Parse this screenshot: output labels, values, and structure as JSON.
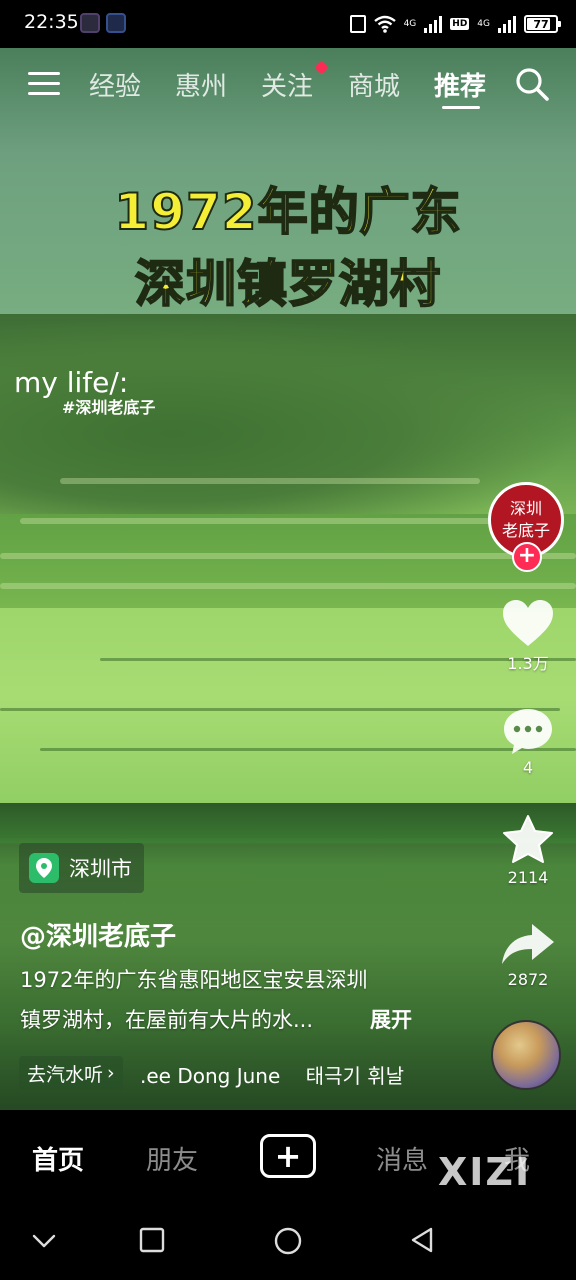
{
  "status_bar": {
    "time": "22:35",
    "network_1": "4G",
    "hd": "HD",
    "network_2": "4G",
    "battery": "77",
    "battery_level": 0.77
  },
  "top_nav": {
    "tabs": [
      "经验",
      "惠州",
      "关注",
      "商城",
      "推荐"
    ],
    "active_tab": "推荐",
    "notification_dot_on": "关注"
  },
  "video": {
    "title_line_1": "1972年的广东",
    "title_line_2": "深圳镇罗湖村",
    "watermark_1": "my life/:",
    "watermark_2": "#深圳老底子"
  },
  "side_actions": {
    "author_avatar_line_1": "深圳",
    "author_avatar_line_2": "老底子",
    "follow_symbol": "+",
    "like_count": "1.3万",
    "comment_count": "4",
    "favorite_count": "2114",
    "share_count": "2872"
  },
  "info": {
    "location": "深圳市",
    "author": "@深圳老底子",
    "description_line_1": "1972年的广东省惠阳地区宝安县深圳",
    "description_line_2": "镇罗湖村，在屋前有大片的水...",
    "expand": "展开",
    "music_chip": "去汽水听",
    "music_chip_arrow": "›",
    "music_title": ".ee Dong June    태극기 휘날"
  },
  "tab_bar": {
    "home": "首页",
    "friends": "朋友",
    "create": "+",
    "messages": "消息",
    "me": "我",
    "watermark": "XIZI"
  },
  "colors": {
    "accent_red": "#fe2c55",
    "title_yellow": "#f4ef36",
    "location_green": "#2dbc6a"
  }
}
